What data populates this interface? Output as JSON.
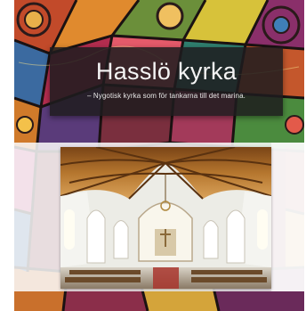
{
  "hero": {
    "title": "Hasslö kyrka",
    "tagline": "– Nygotisk kyrka som för tankarna till det marina."
  },
  "colors": {
    "plate": "#1e1c1e",
    "title_text": "#f4f4f4",
    "band": "#fafafa",
    "wood": "#b5762e"
  },
  "icons": {
    "background": "stained-glass-pattern",
    "photo": "church-interior-photo"
  }
}
